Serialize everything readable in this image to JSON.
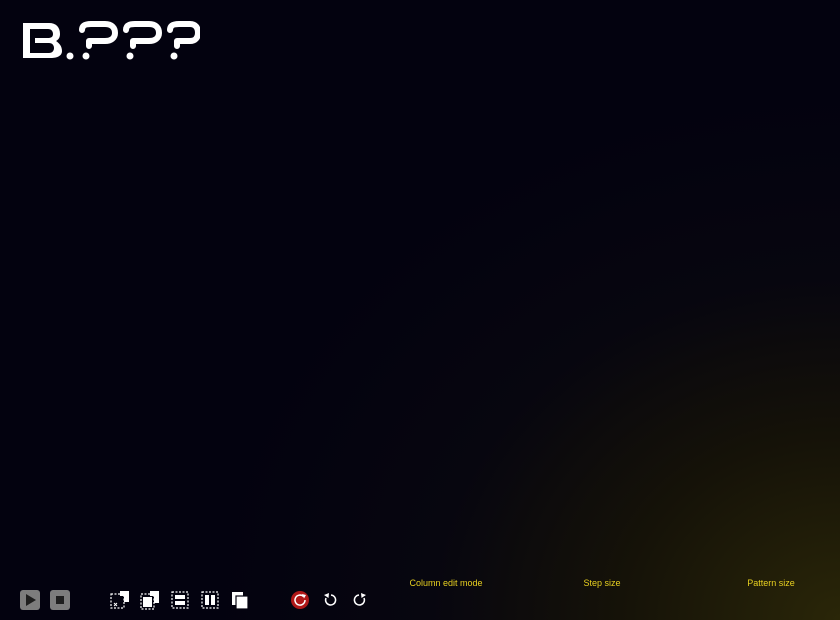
{
  "app": {
    "logo_text": "B.???"
  },
  "toolbar": {
    "play_icon": "play-icon",
    "stop_icon": "stop-icon",
    "edit_icons": [
      "select-clear-icon",
      "select-copy-icon",
      "insert-row-icon",
      "insert-column-icon",
      "duplicate-icon"
    ],
    "history_icons": [
      "reset-icon",
      "undo-icon",
      "redo-icon"
    ],
    "reset_color": "#b01818",
    "labels": {
      "column_edit_mode": "Column edit mode",
      "step_size": "Step size",
      "pattern_size": "Pattern size"
    },
    "label_color": "#e8d020"
  }
}
